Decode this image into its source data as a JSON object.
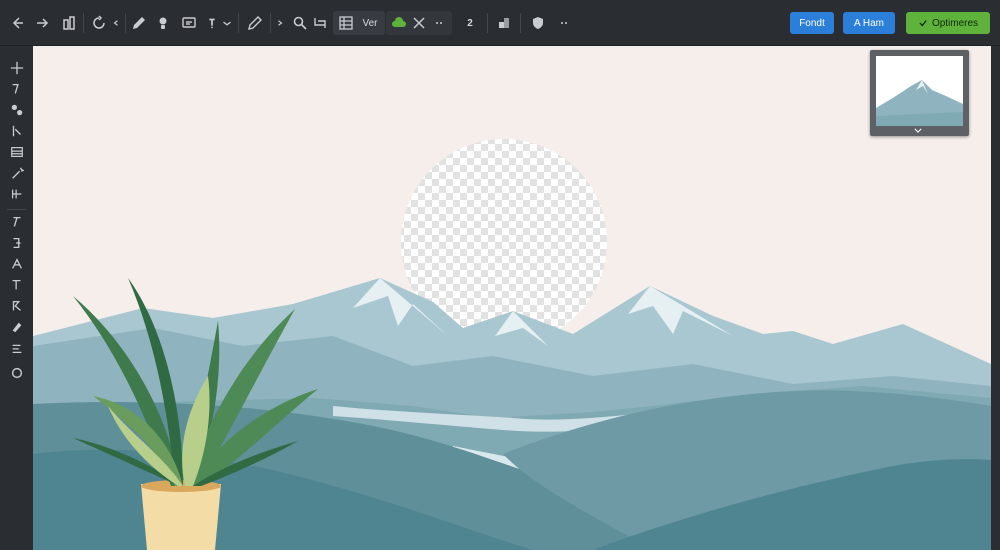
{
  "toolbar": {
    "view_label": "Ver",
    "shortcut_label": "2",
    "buttons": {
      "fonts": "Fondt",
      "text": "A  Ham",
      "optimize": "Optimeres"
    }
  },
  "icons": {
    "top": [
      "back-icon",
      "forward-icon",
      "layers-icon",
      "rotate-icon",
      "chevron-left-icon",
      "pen-icon",
      "bulb-icon",
      "comment-icon",
      "more-vertical-icon",
      "chevron-down-icon",
      "pencil-icon",
      "chevron-down-icon",
      "search-icon",
      "transform-icon",
      "grid-icon",
      "cloud-icon",
      "close-icon",
      "more-horizontal-icon",
      "stack-icon",
      "shield-icon",
      "chevron-down-icon"
    ],
    "left": [
      "move-tool-icon",
      "lasso-tool-icon",
      "crop-tool-icon",
      "eyedropper-tool-icon",
      "frame-tool-icon",
      "magic-wand-icon",
      "grid-tool-icon",
      "brush-tool-icon",
      "clone-tool-icon",
      "healing-tool-icon",
      "text-tool-icon",
      "path-tool-icon",
      "smudge-tool-icon",
      "gradient-tool-icon",
      "lens-tool-icon"
    ]
  },
  "colors": {
    "accent_blue": "#2b7fd8",
    "accent_green": "#5fb33c",
    "canvas_sky": "#f5eeea",
    "mountain": "#8fb3bf",
    "hills": "#4f8590",
    "plant_leaf": "#4e8a55",
    "pot": "#f3dca6"
  }
}
